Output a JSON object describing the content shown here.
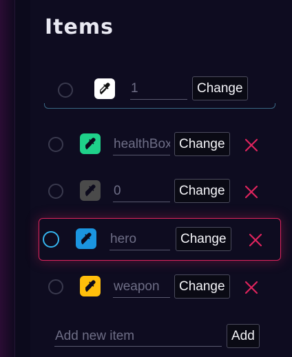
{
  "section": {
    "title": "Items"
  },
  "items": [
    {
      "name_value": "1",
      "swatch_color": "#ffffff",
      "icon_color": "#111111",
      "change_label": "Change",
      "deletable": false,
      "selected": false,
      "icon": "eyedropper-icon"
    },
    {
      "name_value": "healthBox",
      "swatch_color": "#1fd18a",
      "icon_color": "#0c0a1c",
      "change_label": "Change",
      "deletable": true,
      "selected": false,
      "icon": "eyedropper-icon"
    },
    {
      "name_value": "0",
      "swatch_color": "#4a4a4a",
      "icon_color": "#0c0a1c",
      "change_label": "Change",
      "deletable": true,
      "selected": false,
      "icon": "eyedropper-icon"
    },
    {
      "name_value": "hero",
      "swatch_color": "#1b95e0",
      "icon_color": "#0c0a1c",
      "change_label": "Change",
      "deletable": true,
      "selected": true,
      "icon": "eyedropper-icon"
    },
    {
      "name_value": "weapon",
      "swatch_color": "#ffbe0b",
      "icon_color": "#0c0a1c",
      "change_label": "Change",
      "deletable": true,
      "selected": false,
      "icon": "eyedropper-icon"
    }
  ],
  "add_item": {
    "placeholder": "Add new item",
    "button_label": "Add"
  },
  "colors": {
    "accent": "#e0245e",
    "selected_radio": "#35b6f0",
    "delete": "#e0245e"
  }
}
